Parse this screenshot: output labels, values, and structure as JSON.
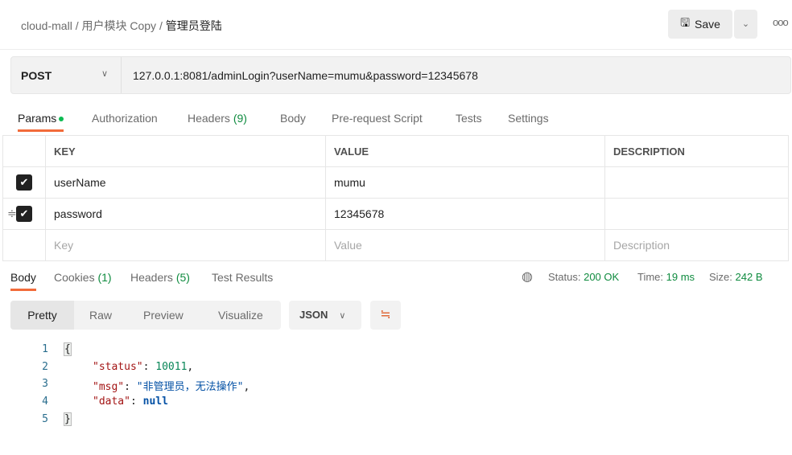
{
  "breadcrumb": {
    "collection": "cloud-mall",
    "folder": "用户模块 Copy",
    "request": "管理员登陆"
  },
  "toolbar": {
    "save_label": "Save",
    "more": "ooo"
  },
  "request": {
    "method": "POST",
    "url": "127.0.0.1:8081/adminLogin?userName=mumu&password=12345678"
  },
  "tabs": [
    "Params",
    "Authorization",
    "Headers",
    "(9)",
    "Body",
    "Pre-request Script",
    "Tests",
    "Settings"
  ],
  "params": {
    "headers": [
      "KEY",
      "VALUE",
      "DESCRIPTION"
    ],
    "rows": [
      {
        "key": "userName",
        "value": "mumu"
      },
      {
        "key": "password",
        "value": "12345678"
      }
    ],
    "placeholders": {
      "key": "Key",
      "value": "Value",
      "description": "Description"
    }
  },
  "response": {
    "tabs": {
      "body": "Body",
      "cookies": "Cookies",
      "cookies_count": "(1)",
      "headers": "Headers",
      "headers_count": "(5)",
      "tests": "Test Results"
    },
    "status_label": "Status:",
    "status": "200 OK",
    "time_label": "Time:",
    "time": "19 ms",
    "size_label": "Size:",
    "size": "242 B",
    "views": [
      "Pretty",
      "Raw",
      "Preview",
      "Visualize"
    ],
    "format": "JSON"
  },
  "code": {
    "lines": [
      "1",
      "2",
      "3",
      "4",
      "5"
    ],
    "open": "{",
    "k1": "\"status\"",
    "v1": "10011",
    "k2": "\"msg\"",
    "v2": "\"非管理员，无法操作\"",
    "k3": "\"data\"",
    "v3": "null",
    "close": "}"
  }
}
